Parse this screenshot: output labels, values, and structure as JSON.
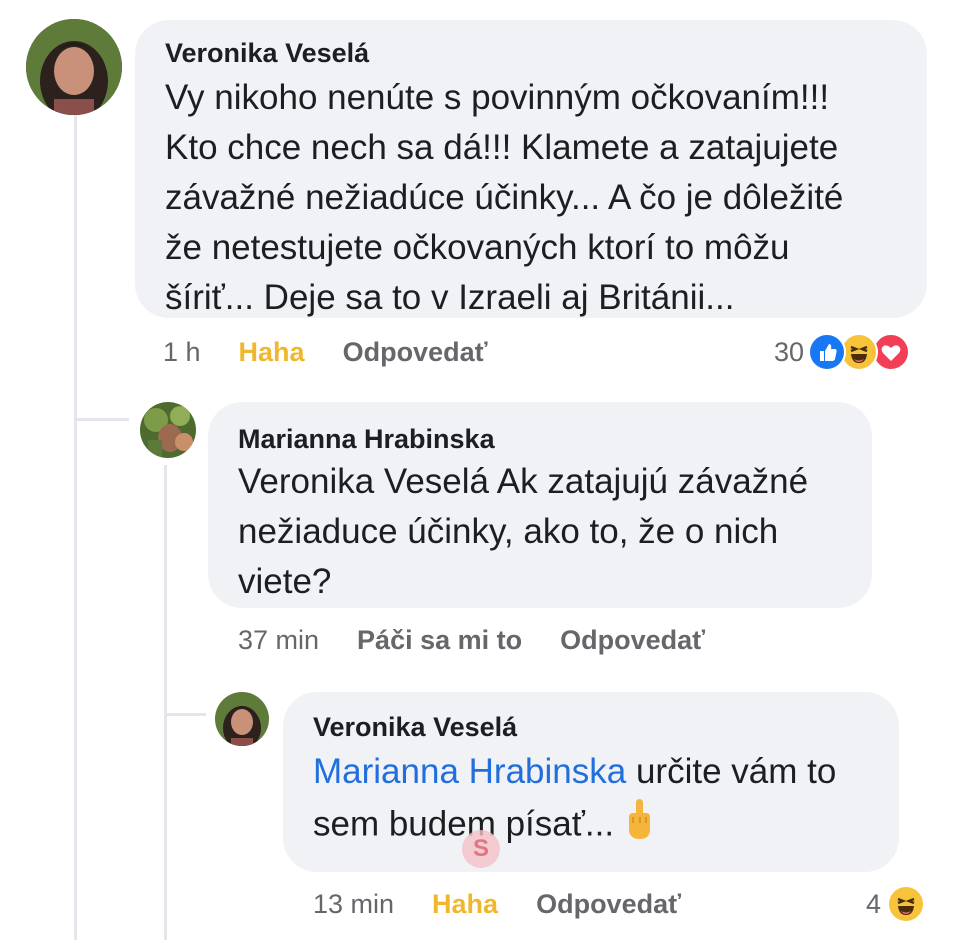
{
  "comments": [
    {
      "author": "Veronika Veselá",
      "text": "Vy nikoho nenúte s povinným očkovaním!!!\nKto chce nech sa dá!!! Klamete a zatajujete\nzávažné nežiadúce účinky... A čo je dôležité\nže netestujete očkovaných ktorí to môžu\nšíriť... Deje sa to v Izraeli aj Británii...",
      "time": "1 h",
      "reaction_label": "Haha",
      "reply_label": "Odpovedať",
      "reaction_count": "30",
      "reactions": [
        "like",
        "haha",
        "love"
      ]
    },
    {
      "author": "Marianna Hrabinska",
      "text": "Veronika Veselá Ak zatajujú závažné\nnežiaduce účinky, ako to, že o nich\nviete?",
      "time": "37 min",
      "reaction_label": "Páči sa mi to",
      "reply_label": "Odpovedať"
    },
    {
      "author": "Veronika Veselá",
      "mention": "Marianna Hrabinska",
      "text": " určite vám to\nsem budem písať... ",
      "time": "13 min",
      "reaction_label": "Haha",
      "reply_label": "Odpovedať",
      "reaction_count": "4",
      "reactions": [
        "haha"
      ]
    }
  ],
  "colors": {
    "bubble": "#f0f2f5",
    "haha_label": "#f0b72e",
    "mention": "#216fdb",
    "secondary_text": "#65676b"
  }
}
